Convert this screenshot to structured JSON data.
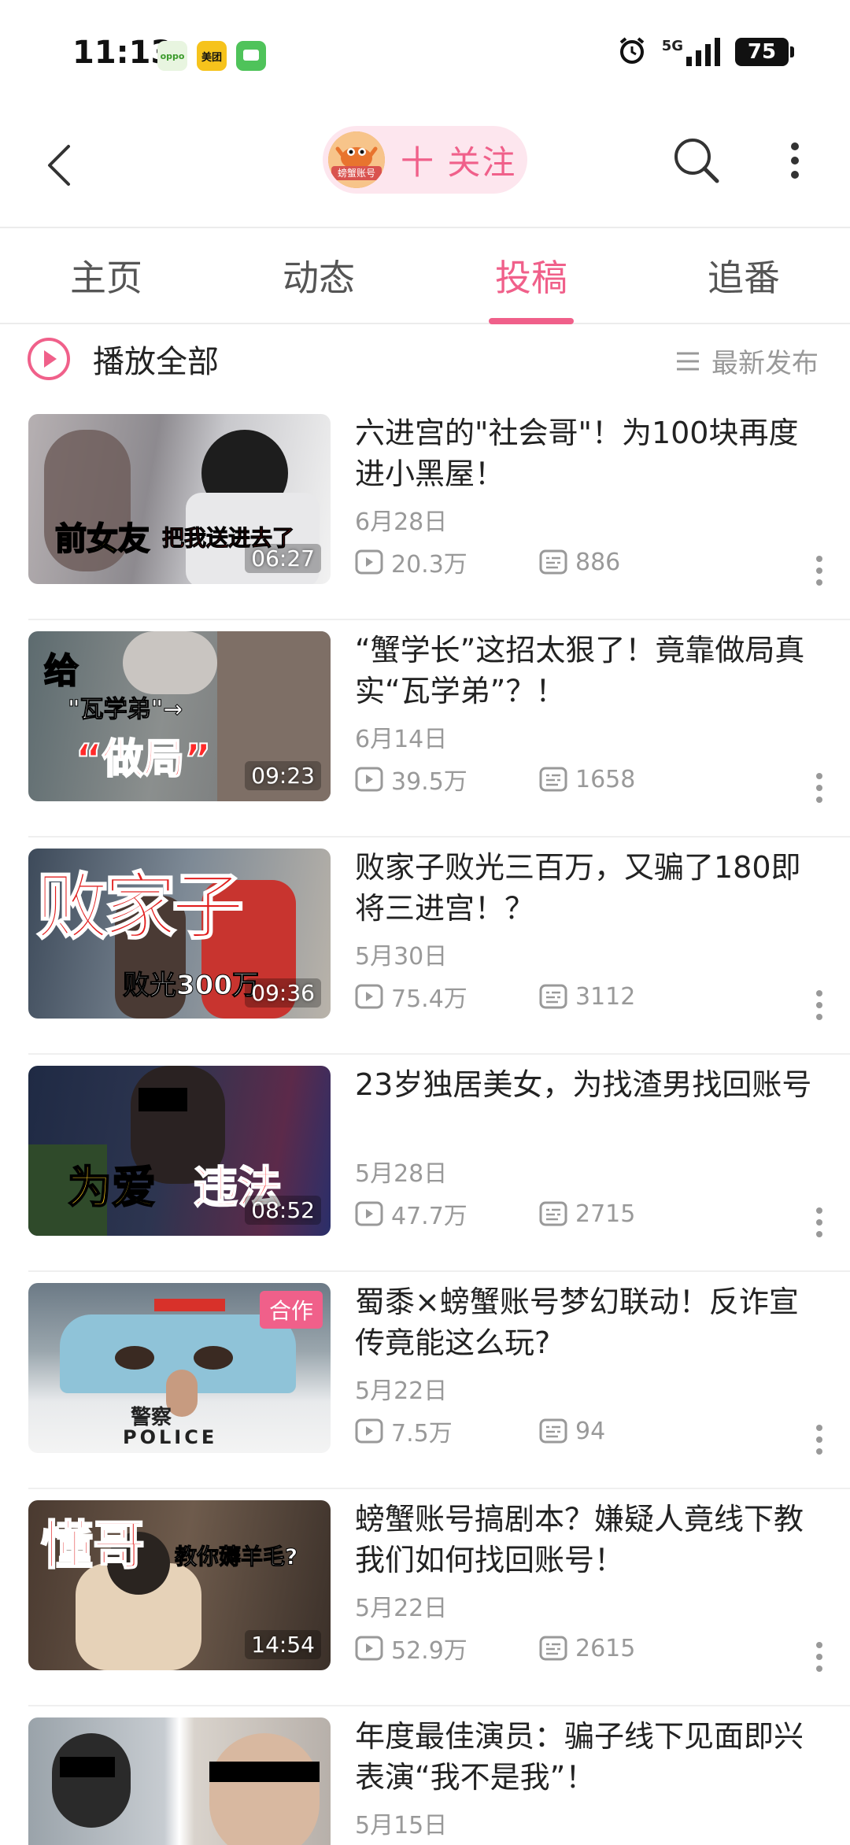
{
  "status_bar": {
    "time": "11:13",
    "app_icons": [
      {
        "name": "oppo-app-icon",
        "label": "oppo",
        "color": "#6cc04a"
      },
      {
        "name": "meituan-app-icon",
        "label": "美团",
        "color": "#f6c31c"
      },
      {
        "name": "message-app-icon",
        "label": "",
        "color": "#4fc35a"
      }
    ],
    "network": "5G",
    "battery": "75"
  },
  "header": {
    "avatar_label": "螃蟹账号",
    "follow_label": "十 关注",
    "accent_color": "#f0608a"
  },
  "tabs": [
    {
      "label": "主页",
      "active": false
    },
    {
      "label": "动态",
      "active": false
    },
    {
      "label": "投稿",
      "active": true
    },
    {
      "label": "追番",
      "active": false
    }
  ],
  "toolbar": {
    "play_all": "播放全部",
    "sort": "最新发布"
  },
  "videos": [
    {
      "title": "六进宫的\"社会哥\"！为100块再度进小黑屋！",
      "date": "6月28日",
      "views": "20.3万",
      "comments": "886",
      "duration": "06:27",
      "thumb_text": "前女友",
      "thumb_text2": "把我送进去了"
    },
    {
      "title": "“蟹学长”这招太狠了！竟靠做局真实“瓦学弟”？！",
      "date": "6月14日",
      "views": "39.5万",
      "comments": "1658",
      "duration": "09:23",
      "thumb_text": "给",
      "thumb_text2": "\"瓦学弟\"→",
      "thumb_text3": "“做局”"
    },
    {
      "title": "败家子败光三百万，又骗了180即将三进宫！？",
      "date": "5月30日",
      "views": "75.4万",
      "comments": "3112",
      "duration": "09:36",
      "thumb_text": "败家子",
      "thumb_text2": "败光300万"
    },
    {
      "title": "23岁独居美女，为找渣男找回账号",
      "date": "5月28日",
      "views": "47.7万",
      "comments": "2715",
      "duration": "08:52",
      "thumb_text": "为爱",
      "thumb_text2": "违法"
    },
    {
      "title": "蜀黍×螃蟹账号梦幻联动！反诈宣传竟能这么玩?",
      "date": "5月22日",
      "views": "7.5万",
      "comments": "94",
      "duration": "",
      "badge": "合作",
      "thumb_text": "警察",
      "thumb_text2": "POLICE"
    },
    {
      "title": "螃蟹账号搞剧本？嫌疑人竟线下教我们如何找回账号！",
      "date": "5月22日",
      "views": "52.9万",
      "comments": "2615",
      "duration": "14:54",
      "thumb_text": "懂哥",
      "thumb_text2": "教你薅羊毛?"
    },
    {
      "title": "年度最佳演员：骗子线下见面即兴表演“我不是我”！",
      "date": "5月15日",
      "views": "",
      "comments": "",
      "duration": "",
      "thumb_text": "",
      "thumb_text2": ""
    }
  ]
}
